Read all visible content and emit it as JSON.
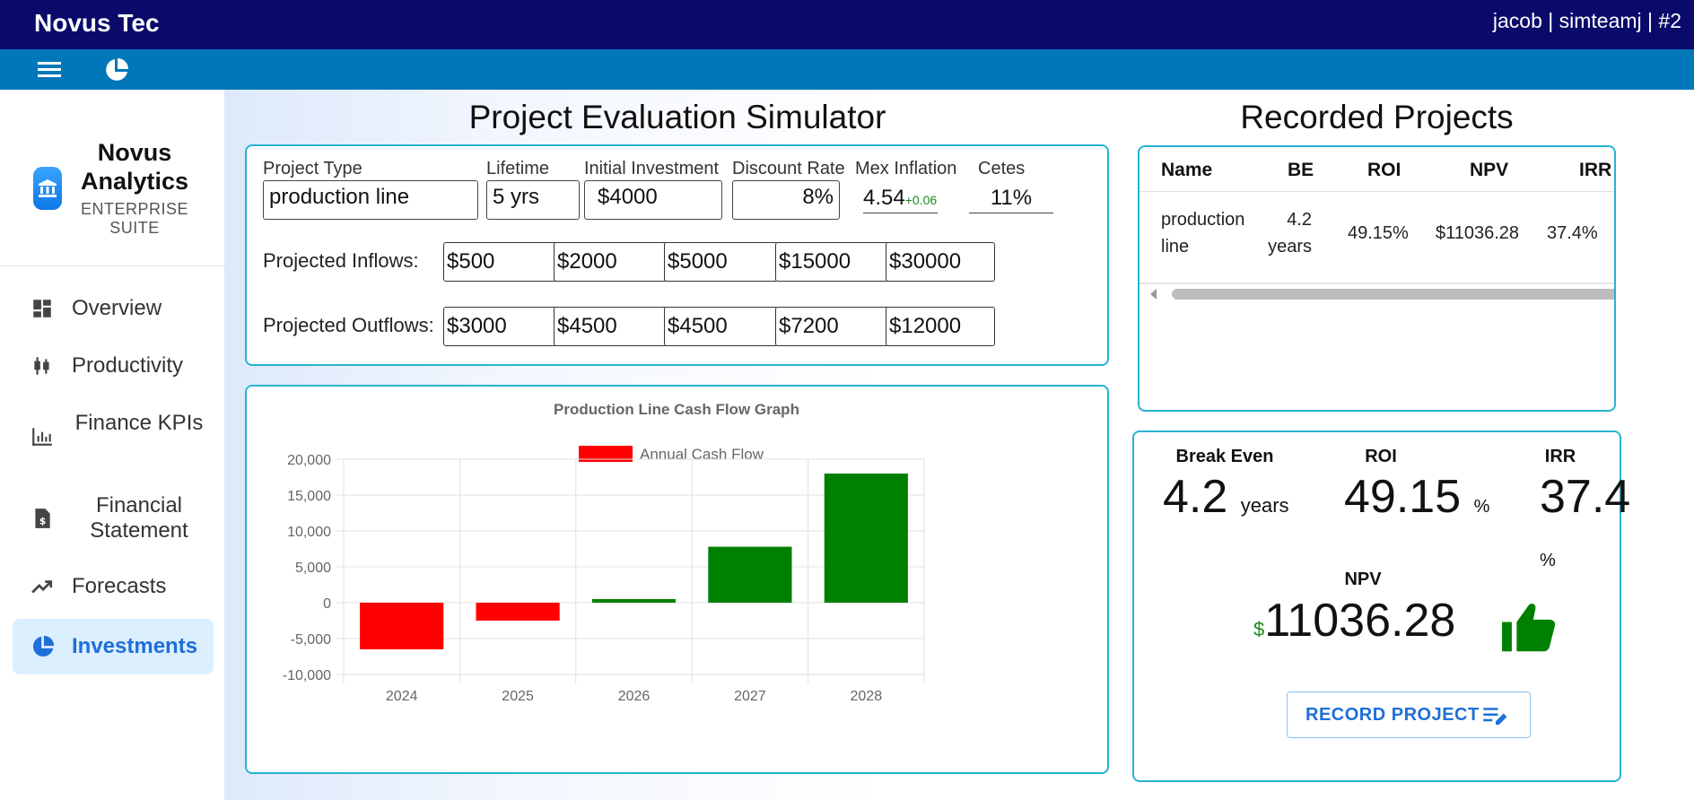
{
  "app": {
    "brand": "Novus Tec",
    "user_info": "jacob | simteamj | #2"
  },
  "toolbar": {
    "menu_icon": "hamburger-menu-icon",
    "section_icon": "pie-chart-icon"
  },
  "sidebar": {
    "title": "Novus Analytics",
    "subtitle": "ENTERPRISE SUITE",
    "logo_icon": "bank-icon",
    "items": [
      {
        "label": "Overview",
        "icon": "dashboard-icon"
      },
      {
        "label": "Productivity",
        "icon": "candlestick-icon"
      },
      {
        "label": "Finance KPIs",
        "icon": "bar-chart-icon"
      },
      {
        "label": "Financial Statement",
        "icon": "invoice-icon"
      },
      {
        "label": "Forecasts",
        "icon": "trending-up-icon"
      },
      {
        "label": "Investments",
        "icon": "pie-chart-icon",
        "active": true
      }
    ]
  },
  "simulator": {
    "title": "Project Evaluation Simulator",
    "fields": {
      "project_type": {
        "label": "Project Type",
        "value": "production line"
      },
      "lifetime": {
        "label": "Lifetime",
        "value": "5 yrs"
      },
      "initial_investment": {
        "label": "Initial Investment",
        "value": "$4000"
      },
      "discount_rate": {
        "label": "Discount Rate",
        "value": "8%"
      },
      "mex_inflation": {
        "label": "Mex Inflation",
        "value": "4.54",
        "delta": "+0.06"
      },
      "cetes": {
        "label": "Cetes",
        "value": "11%"
      }
    },
    "inflows_label": "Projected Inflows:",
    "inflows": [
      "$500",
      "$2000",
      "$5000",
      "$15000",
      "$30000"
    ],
    "outflows_label": "Projected Outflows:",
    "outflows": [
      "$3000",
      "$4500",
      "$4500",
      "$7200",
      "$12000"
    ]
  },
  "chart_data": {
    "type": "bar",
    "title": "Production Line Cash Flow Graph",
    "legend": "Annual Cash Flow",
    "legend_position": "top",
    "categories": [
      "2024",
      "2025",
      "2026",
      "2027",
      "2028"
    ],
    "series": [
      {
        "name": "Annual Cash Flow",
        "values": [
          -6500,
          -2500,
          500,
          7800,
          18000
        ]
      }
    ],
    "ylim": [
      -10000,
      20000
    ],
    "yticks": [
      "20,000",
      "15,000",
      "10,000",
      "5,000",
      "0",
      "-5,000",
      "-10,000"
    ],
    "grid": true,
    "colors": {
      "negative": "#ff0000",
      "positive": "#008000"
    }
  },
  "recorded": {
    "title": "Recorded Projects",
    "headers": [
      "Name",
      "BE",
      "ROI",
      "NPV",
      "IRR"
    ],
    "rows": [
      {
        "name": "production line",
        "be": "4.2 years",
        "roi": "49.15%",
        "npv": "$11036.28",
        "irr": "37.4%"
      }
    ]
  },
  "results": {
    "break_even": {
      "label": "Break Even",
      "value": "4.2",
      "unit": "years"
    },
    "roi": {
      "label": "ROI",
      "value": "49.15",
      "unit": "%"
    },
    "irr": {
      "label": "IRR",
      "value": "37.4",
      "unit": "%"
    },
    "npv": {
      "label": "NPV",
      "currency": "$",
      "value": "11036.28",
      "icon": "thumbs-up-icon",
      "icon_color": "#008000"
    },
    "record_button": "RECORD PROJECT",
    "record_icon": "edit-note-icon"
  },
  "colors": {
    "header": "#0a0a6b",
    "toolbar": "#0077b8",
    "accent": "#1e6fd9",
    "card_border": "#27b3d2"
  }
}
